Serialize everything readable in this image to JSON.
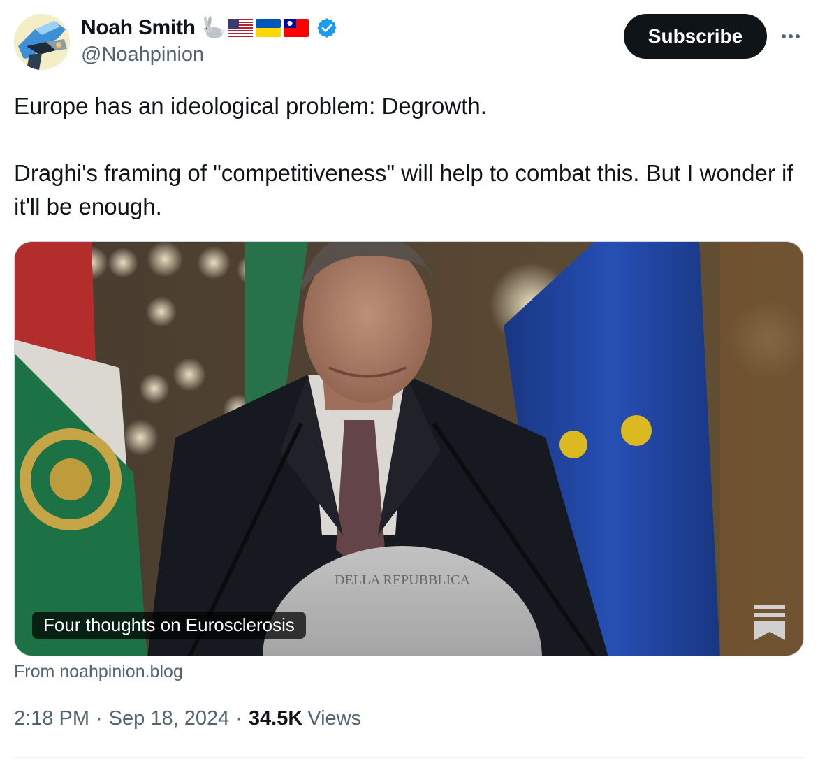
{
  "author": {
    "display_name": "Noah Smith",
    "handle": "@Noahpinion",
    "name_emojis": [
      "rabbit-emoji",
      "us-flag-emoji",
      "ukraine-flag-emoji",
      "taiwan-flag-emoji"
    ],
    "verified_icon": "verified-badge-icon"
  },
  "actions": {
    "subscribe_label": "Subscribe",
    "more_icon": "more-options-icon"
  },
  "tweet": {
    "paragraphs": [
      "Europe has an ideological problem: Degrowth.",
      "Draghi's framing of \"competitiveness\" will help to combat this. But I wonder if it'll be enough."
    ]
  },
  "link_card": {
    "title": "Four thoughts on Eurosclerosis",
    "publisher_icon": "substack-logo-icon",
    "source": "From noahpinion.blog",
    "podium_text": "DELLA REPUBBLICA"
  },
  "meta": {
    "time": "2:18 PM",
    "date": "Sep 18, 2024",
    "views_count": "34.5K",
    "views_label": "Views",
    "separator": "·"
  },
  "colors": {
    "text_primary": "#0f1419",
    "text_secondary": "#536471",
    "verified_blue": "#1d9bf0",
    "border": "#cfd9de"
  }
}
